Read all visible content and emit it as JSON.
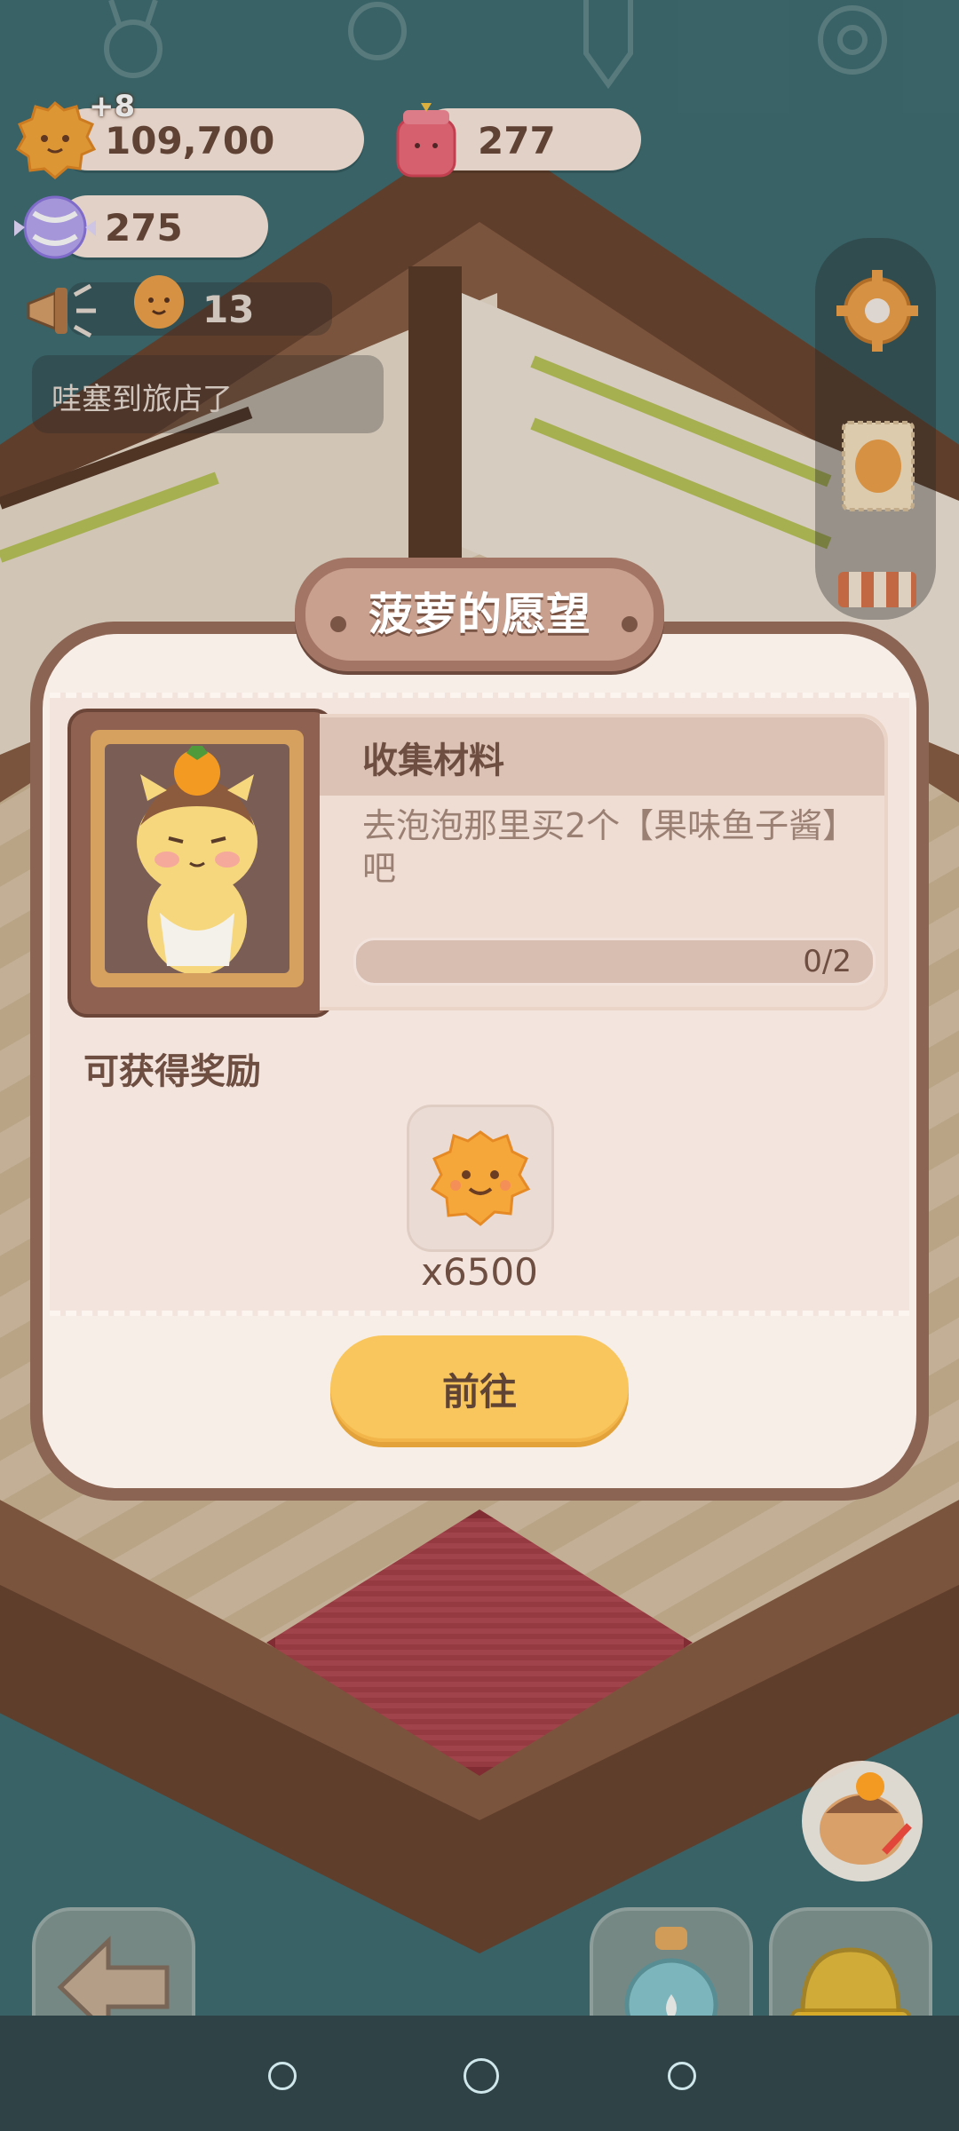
{
  "hud": {
    "coins": {
      "icon": "cookie-coin-icon",
      "value": "109,700",
      "bonus": "+8"
    },
    "gems": {
      "icon": "jam-jar-icon",
      "value": "277"
    },
    "candy": {
      "icon": "candy-icon",
      "value": "275"
    },
    "guests": {
      "icon": "cookie-guest-icon",
      "value": "13"
    },
    "notification": "哇塞到旅店了"
  },
  "side_menu": [
    "gear-icon",
    "stamp-icon",
    "shop-awning-icon"
  ],
  "dialog": {
    "title": "菠萝的愿望",
    "task": {
      "heading": "收集材料",
      "description": "去泡泡那里买2个【果味鱼子酱】吧",
      "progress_text": "0/2",
      "progress_fraction": 0
    },
    "reward": {
      "heading": "可获得奖励",
      "item_icon": "cookie-coin-icon",
      "quantity": "x6500"
    },
    "go_button": "前往"
  },
  "bottom_bar": [
    "back-arrow-icon",
    "potion-bottle-icon",
    "hard-hat-icon"
  ],
  "colors": {
    "accent": "#f8c65c",
    "dialog_border": "#8b6454",
    "text_brown": "#6d4e41"
  }
}
